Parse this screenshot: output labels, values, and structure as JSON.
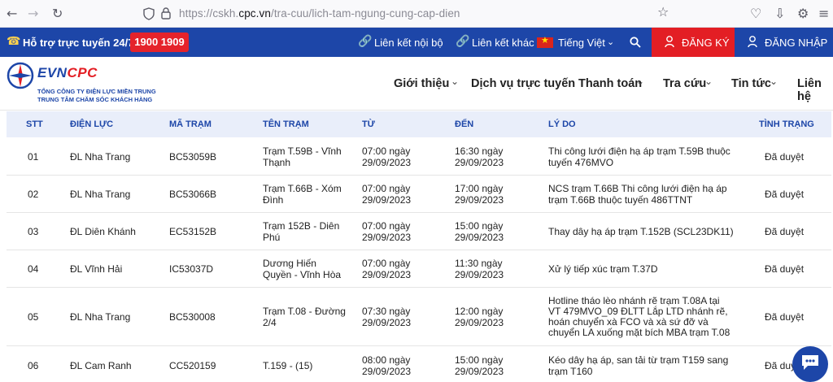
{
  "browser": {
    "url_prefix": "https://cskh.",
    "url_domain": "cpc.vn",
    "url_path": "/tra-cuu/lich-tam-ngung-cung-cap-dien"
  },
  "topbar": {
    "hotline_label": "Hỗ trợ trực tuyến 24/7:",
    "hotline_number": "1900 1909",
    "internal_link": "Liên kết nội bộ",
    "other_link": "Liên kết khác",
    "language": "Tiếng Việt",
    "register": "ĐĂNG KÝ",
    "login": "ĐĂNG NHẬP"
  },
  "header": {
    "logo_evn": "EVN",
    "logo_cpc": "CPC",
    "logo_line1": "TỔNG CÔNG TY ĐIỆN LỰC MIỀN TRUNG",
    "logo_line2": "TRUNG TÂM CHĂM SÓC KHÁCH HÀNG",
    "nav": [
      "Giới thiệu",
      "Dịch vụ trực tuyến",
      "Thanh toán",
      "Tra cứu",
      "Tin tức",
      "Liên hệ"
    ]
  },
  "table": {
    "headers": [
      "STT",
      "ĐIỆN LỰC",
      "MÃ TRẠM",
      "TÊN TRẠM",
      "TỪ",
      "ĐẾN",
      "LÝ DO",
      "TÌNH TRẠNG"
    ],
    "rows": [
      {
        "stt": "01",
        "dien_luc": "ĐL Nha Trang",
        "ma_tram": "BC53059B",
        "ten_tram": [
          "Trạm T.59B - Vĩnh",
          "Thạnh"
        ],
        "tu": [
          "07:00 ngày",
          "29/09/2023"
        ],
        "den": [
          "16:30 ngày",
          "29/09/2023"
        ],
        "ly_do": [
          "Thi công lưới điện hạ áp trạm T.59B thuộc",
          "tuyến 476MVO"
        ],
        "tinh_trang": "Đã duyệt"
      },
      {
        "stt": "02",
        "dien_luc": "ĐL Nha Trang",
        "ma_tram": "BC53066B",
        "ten_tram": [
          "Trạm T.66B - Xóm",
          "Đình"
        ],
        "tu": [
          "07:00 ngày",
          "29/09/2023"
        ],
        "den": [
          "17:00 ngày",
          "29/09/2023"
        ],
        "ly_do": [
          "NCS trạm T.66B Thi công lưới điện hạ áp",
          "trạm T.66B thuộc tuyến 486TTNT"
        ],
        "tinh_trang": "Đã duyệt"
      },
      {
        "stt": "03",
        "dien_luc": "ĐL Diên Khánh",
        "ma_tram": "EC53152B",
        "ten_tram": [
          "Trạm 152B - Diên",
          "Phú"
        ],
        "tu": [
          "07:00 ngày",
          "29/09/2023"
        ],
        "den": [
          "15:00 ngày",
          "29/09/2023"
        ],
        "ly_do": [
          "Thay dây hạ áp trạm T.152B (SCL23DK11)"
        ],
        "tinh_trang": "Đã duyệt"
      },
      {
        "stt": "04",
        "dien_luc": "ĐL Vĩnh Hải",
        "ma_tram": "IC53037D",
        "ten_tram": [
          "Dương Hiến",
          "Quyền - Vĩnh Hòa"
        ],
        "tu": [
          "07:00 ngày",
          "29/09/2023"
        ],
        "den": [
          "11:30 ngày",
          "29/09/2023"
        ],
        "ly_do": [
          "Xử lý tiếp xúc trạm T.37D"
        ],
        "tinh_trang": "Đã duyệt"
      },
      {
        "stt": "05",
        "dien_luc": "ĐL Nha Trang",
        "ma_tram": "BC530008",
        "ten_tram": [
          "Trạm T.08 - Đường",
          "2/4"
        ],
        "tu": [
          "07:30 ngày",
          "29/09/2023"
        ],
        "den": [
          "12:00 ngày",
          "29/09/2023"
        ],
        "ly_do": [
          "Hotline tháo lèo nhánh rẽ trạm T.08A tại",
          "VT 479MVO_09 ĐLTT Lắp LTD nhánh rẽ,",
          "hoán chuyển xà FCO và xà sứ đỡ và",
          "chuyển LA xuống mặt bích MBA trạm T.08"
        ],
        "tinh_trang": "Đã duyệt"
      },
      {
        "stt": "06",
        "dien_luc": "ĐL Cam Ranh",
        "ma_tram": "CC520159",
        "ten_tram": [
          "T.159 - (15)"
        ],
        "tu": [
          "08:00 ngày",
          "29/09/2023"
        ],
        "den": [
          "15:00 ngày",
          "29/09/2023"
        ],
        "ly_do": [
          "Kéo dây hạ áp, san tải từ trạm T159 sang",
          "trạm T160"
        ],
        "tinh_trang": "Đã duyệt"
      }
    ]
  },
  "colors": {
    "brand_blue": "#1d46a8",
    "brand_red": "#e31e24",
    "header_bg": "#e9eefa"
  }
}
